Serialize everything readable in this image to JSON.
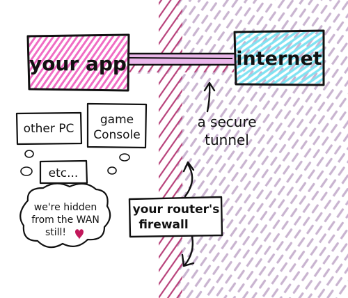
{
  "nodes": {
    "your_app": "your app",
    "internet": "internet",
    "other_pc": "other PC",
    "game_console_line1": "game",
    "game_console_line2": "Console",
    "etc": "etc..."
  },
  "labels": {
    "tunnel_line1": "a secure",
    "tunnel_line2": "tunnel",
    "firewall_line1": "your router's",
    "firewall_line2": "firewall",
    "hidden_line1": "we're hidden",
    "hidden_line2": "from the WAN",
    "hidden_line3": "still!"
  },
  "colors": {
    "pink": "#f06cc4",
    "cyan": "#7fe3f2",
    "purple_hatch": "#c9b4d0",
    "magenta_hatch": "#b8417a",
    "heart": "#c2185b",
    "ink": "#111111"
  }
}
